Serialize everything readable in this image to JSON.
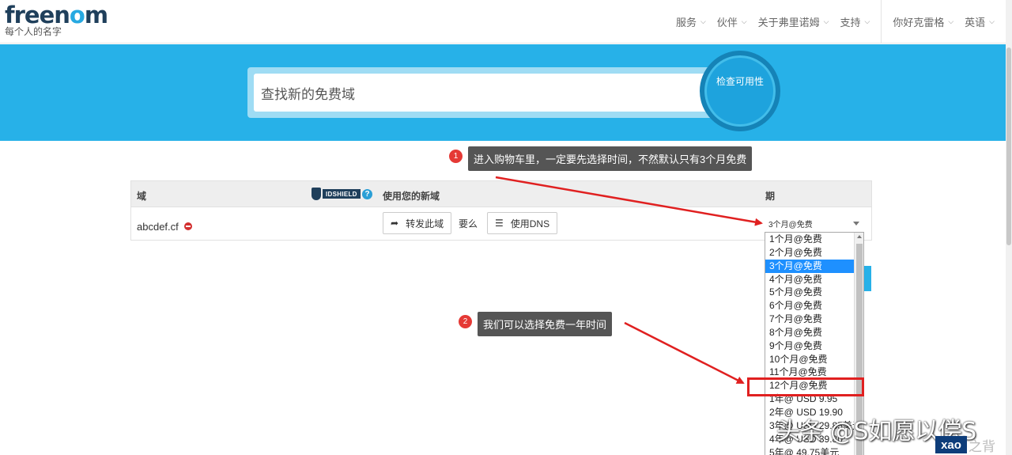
{
  "header": {
    "logo_text_a": "free",
    "logo_text_b": "n",
    "logo_text_c": "o",
    "logo_text_d": "m",
    "tagline": "每个人的名字",
    "nav": [
      "服务",
      "伙伴",
      "关于弗里诺姆",
      "支持"
    ],
    "user_menu": "你好克雷格",
    "language": "英语"
  },
  "hero": {
    "search_placeholder": "查找新的免费域",
    "check_button": "检查可用性"
  },
  "table": {
    "col_domain": "域",
    "idshield_label": "IDSHIELD",
    "help_icon": "?",
    "col_use": "使用您的新域",
    "col_period": "期",
    "row": {
      "domain": "abcdef.cf",
      "forward_button": "转发此域",
      "or_text": "要么",
      "dns_button": "使用DNS",
      "period_value": "3个月@免费"
    }
  },
  "dropdown": {
    "options": [
      "1个月@免费",
      "2个月@免费",
      "3个月@免费",
      "4个月@免费",
      "5个月@免费",
      "6个月@免费",
      "7个月@免费",
      "8个月@免费",
      "9个月@免费",
      "10个月@免费",
      "11个月@免费",
      "12个月@免费",
      "1年@ USD 9.95",
      "2年@ USD 19.90",
      "3年@ USD 29.85美元",
      "4年@ USD 39.80",
      "5年@ 49.75美元"
    ],
    "selected": "3个月@免费"
  },
  "annotations": {
    "step1_num": "1",
    "step1_text": "进入购物车里，一定要先选择时间，不然默认只有3个月免费",
    "step2_num": "2",
    "step2_text": "我们可以选择免费一年时间"
  },
  "watermark": {
    "text": "头条 @S如愿以偿S",
    "badge": "xao",
    "badge_tail": "之背"
  },
  "colors": {
    "hero": "#27b1e8",
    "brand_dark": "#1f3f5b",
    "annotation_red": "#e02020",
    "selected": "#1e90ff"
  }
}
